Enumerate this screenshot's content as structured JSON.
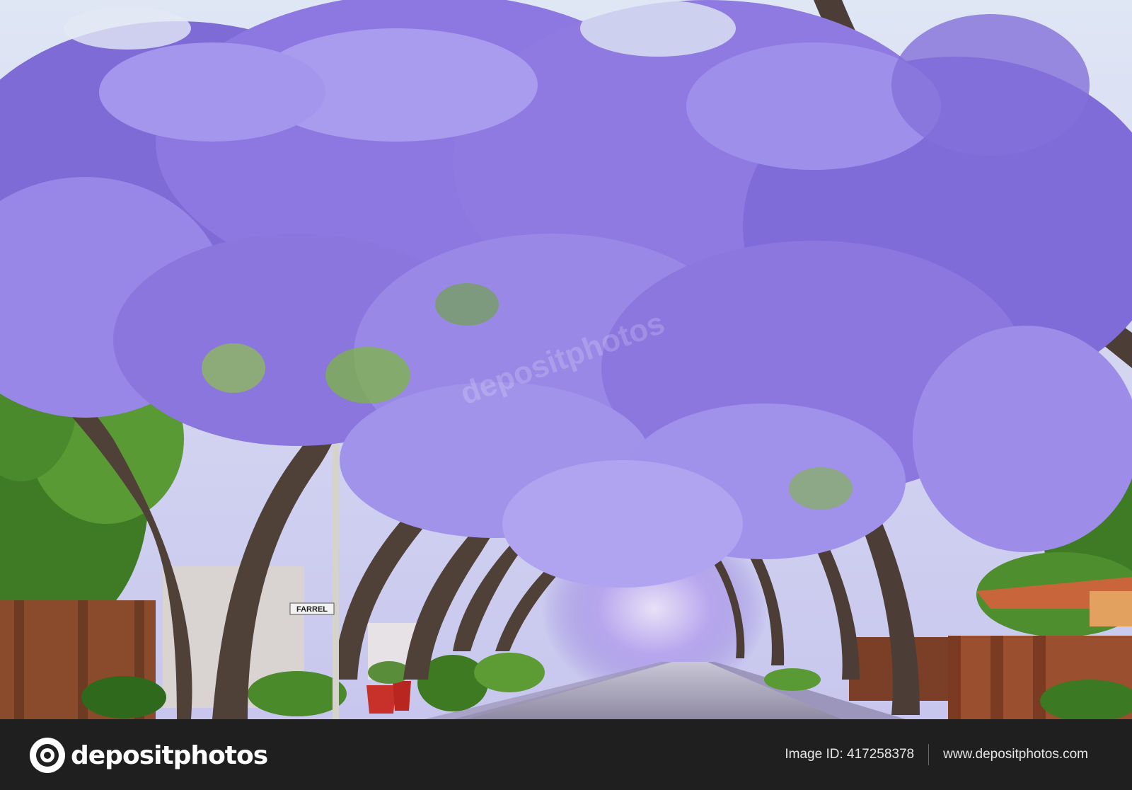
{
  "scene": {
    "street_sign": "FARREL",
    "watermark": "depositphotos"
  },
  "footer": {
    "logo_text": "depositphotos",
    "logo_icon": "camera-lens-icon",
    "image_id": "Image ID: 417258378",
    "website": "www.depositphotos.com"
  },
  "colors": {
    "footer_bg": "#1f1f1f",
    "jacaranda": "#8e7ae0",
    "foliage": "#4c8a2e",
    "brick": "#8a4a2c"
  }
}
